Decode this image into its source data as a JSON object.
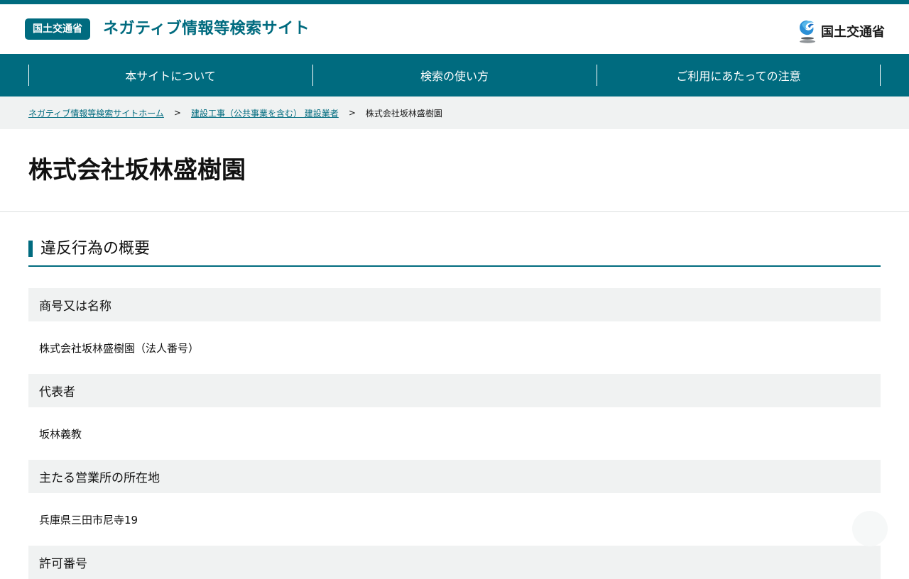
{
  "header": {
    "badge": "国土交通省",
    "site_title": "ネガティブ情報等検索サイト",
    "logo_text": "国土交通省"
  },
  "nav": [
    {
      "label": "本サイトについて"
    },
    {
      "label": "検索の使い方"
    },
    {
      "label": "ご利用にあたっての注意"
    }
  ],
  "breadcrumb": {
    "home": "ネガティブ情報等検索サイトホーム",
    "category": "建設工事（公共事業を含む） 建設業者",
    "separator": ">",
    "current": "株式会社坂林盛樹園"
  },
  "page": {
    "title": "株式会社坂林盛樹園",
    "section_heading": "違反行為の概要"
  },
  "fields": [
    {
      "label": "商号又は名称",
      "value": "株式会社坂林盛樹園（法人番号）"
    },
    {
      "label": "代表者",
      "value": "坂林義教"
    },
    {
      "label": "主たる営業所の所在地",
      "value": "兵庫県三田市尼寺19"
    },
    {
      "label": "許可番号",
      "value": ""
    }
  ],
  "colors": {
    "brand": "#006b7f",
    "label_bg": "#f0f2f2"
  }
}
